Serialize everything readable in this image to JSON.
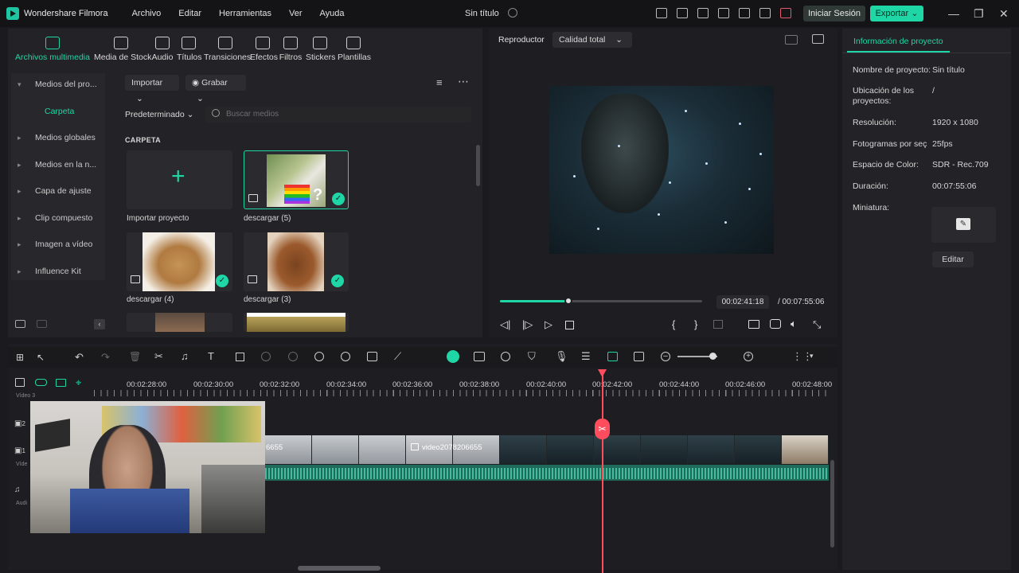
{
  "titlebar": {
    "app_name": "Wondershare Filmora",
    "menu": [
      "Archivo",
      "Editar",
      "Herramientas",
      "Ver",
      "Ayuda"
    ],
    "doc_title": "Sin título",
    "login_label": "Iniciar Sesión",
    "export_label": "Exportar",
    "colors": {
      "accent": "#1fd6a6",
      "bg": "#141417"
    }
  },
  "media": {
    "tabs": [
      "Archivos multimedia",
      "Media de Stock",
      "Audio",
      "Títulos",
      "Transiciones",
      "Efectos",
      "Filtros",
      "Stickers",
      "Plantillas"
    ],
    "sidebar": {
      "project_media": "Medios del pro...",
      "folder": "Carpeta",
      "items": [
        "Medios globales",
        "Medios en la n...",
        "Capa de ajuste",
        "Clip compuesto",
        "Imagen a vídeo",
        "Influence Kit"
      ]
    },
    "import_label": "Importar",
    "record_label": "Grabar",
    "sort_label": "Predeterminado",
    "search_placeholder": "Buscar medios",
    "section_label": "CARPETA",
    "import_project_label": "Importar proyecto",
    "items": [
      {
        "label": "descargar (5)"
      },
      {
        "label": "descargar (4)"
      },
      {
        "label": "descargar (3)"
      }
    ]
  },
  "player": {
    "tab_label": "Reproductor",
    "quality_label": "Calidad total",
    "current_time": "00:02:41:18",
    "total_time": "/ 00:07:55:06",
    "progress": 0.34
  },
  "info": {
    "tab_label": "Información de proyecto",
    "rows": [
      {
        "label": "Nombre de proyecto:",
        "value": "Sin título"
      },
      {
        "label": "Ubicación de los proyectos:",
        "value": "/"
      },
      {
        "label": "Resolución:",
        "value": "1920 x 1080"
      },
      {
        "label": "Fotogramas por seç",
        "value": "25fps"
      },
      {
        "label": "Espacio de Color:",
        "value": "SDR - Rec.709"
      },
      {
        "label": "Duración:",
        "value": "00:07:55:06"
      },
      {
        "label": "Miniatura:",
        "value": ""
      }
    ],
    "edit_label": "Editar"
  },
  "timeline": {
    "ruler": [
      "00:02:28:00",
      "00:02:30:00",
      "00:02:32:00",
      "00:02:34:00",
      "00:02:36:00",
      "00:02:38:00",
      "00:02:40:00",
      "00:02:42:00",
      "00:02:44:00",
      "00:02:46:00",
      "00:02:48:00"
    ],
    "clip_name": "video2078206655",
    "clip_name_partial": "6655",
    "tracks": {
      "video3": "Vídeo 3",
      "video": "Víde",
      "audio": "Audi",
      "track2": "2",
      "track1": "1"
    }
  }
}
